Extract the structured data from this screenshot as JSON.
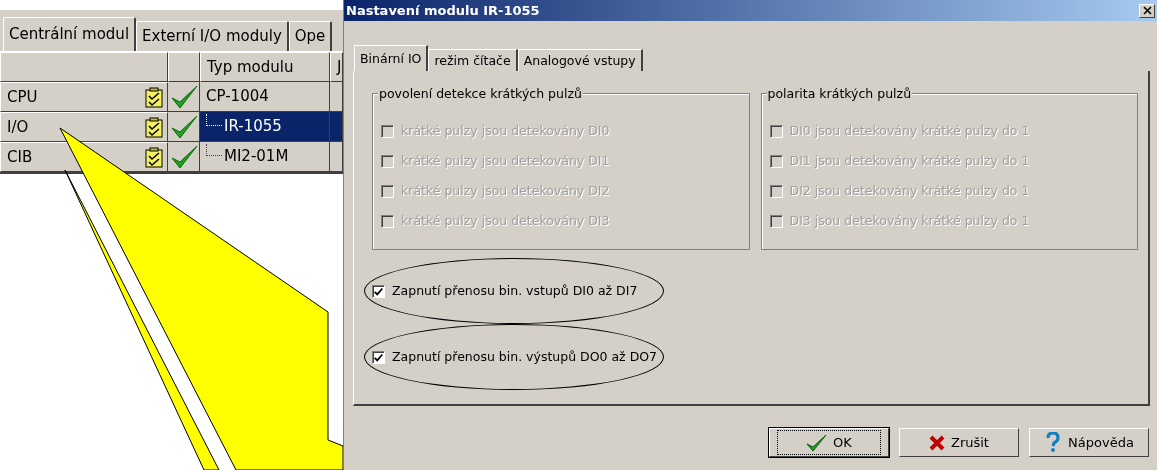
{
  "background_window": {
    "tabs": [
      {
        "label": "Centrální modul",
        "selected": true
      },
      {
        "label": "Externí I/O moduly",
        "selected": false
      },
      {
        "label": "Ope",
        "selected": false
      }
    ],
    "table": {
      "columns": [
        "Typ modulu",
        "J"
      ],
      "rows": [
        {
          "group": "CPU",
          "module": "CP-1004",
          "child": false,
          "selected": false
        },
        {
          "group": "I/O",
          "module": "IR-1055",
          "child": true,
          "selected": true
        },
        {
          "group": "CIB",
          "module": "MI2-01M",
          "child": true,
          "selected": false
        }
      ]
    }
  },
  "dialog": {
    "title": "Nastavení modulu IR-1055",
    "tabs": [
      {
        "label": "Binární IO",
        "selected": true
      },
      {
        "label": "režim čítače",
        "selected": false
      },
      {
        "label": "Analogové vstupy",
        "selected": false
      }
    ],
    "groups": [
      {
        "title": "povolení detekce krátkých pulzů",
        "options": [
          {
            "label": "krátké pulzy jsou detekovány DI0",
            "checked": false,
            "disabled": true
          },
          {
            "label": "krátké pulzy jsou detekovány DI1",
            "checked": false,
            "disabled": true
          },
          {
            "label": "krátké pulzy jsou detekovány DI2",
            "checked": false,
            "disabled": true
          },
          {
            "label": "krátké pulzy jsou detekovány DI3",
            "checked": false,
            "disabled": true
          }
        ]
      },
      {
        "title": "polarita krátkých pulzů",
        "options": [
          {
            "label": "DI0 jsou detekovány krátké pulzy do 1",
            "checked": false,
            "disabled": true
          },
          {
            "label": "DI1 jsou detekovány krátké pulzy do 1",
            "checked": false,
            "disabled": true
          },
          {
            "label": "DI2 jsou detekovány krátké pulzy do 1",
            "checked": false,
            "disabled": true
          },
          {
            "label": "DI3 jsou detekovány krátké pulzy do 1",
            "checked": false,
            "disabled": true
          }
        ]
      }
    ],
    "options": [
      {
        "label": "Zapnutí přenosu bin. vstupů DI0 až DI7",
        "checked": true,
        "disabled": false,
        "circled": true
      },
      {
        "label": "Zapnutí přenosu bin. výstupů DO0 až DO7",
        "checked": true,
        "disabled": false,
        "circled": true
      }
    ],
    "buttons": [
      {
        "label": "OK",
        "kind": "ok",
        "default": true
      },
      {
        "label": "Zrušit",
        "kind": "cancel",
        "default": false
      },
      {
        "label": "Nápověda",
        "kind": "help",
        "default": false
      }
    ]
  }
}
